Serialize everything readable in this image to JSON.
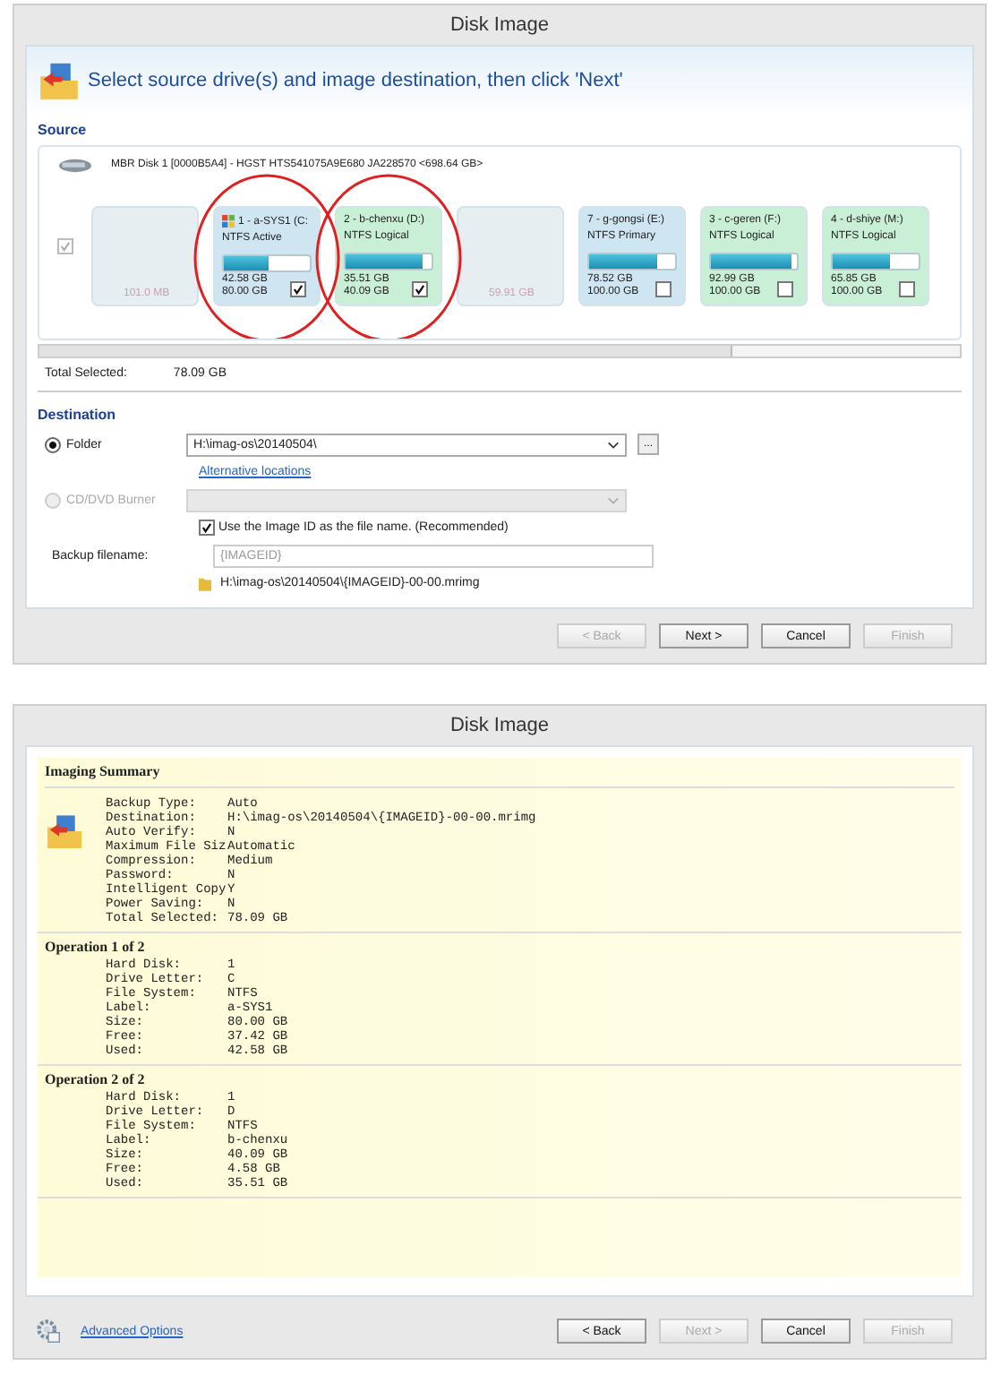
{
  "source_dialog": {
    "title": "Disk Image",
    "instruction": "Select source drive(s) and image destination, then click 'Next'",
    "source": {
      "heading": "Source",
      "disk_label": "MBR Disk 1 [0000B5A4] - HGST HTS541075A9E680 JA228570  <698.64 GB>",
      "disk_checked": true,
      "disk_disabled": true,
      "partitions": [
        {
          "kind": "unallocated",
          "size": "101.0 MB"
        },
        {
          "kind": "primary",
          "name": "1 - a-SYS1 (C:",
          "fs": "NTFS Active",
          "system": true,
          "highlighted": true,
          "level": 0.53,
          "used": "42.58 GB",
          "total": "80.00 GB",
          "checked": true
        },
        {
          "kind": "logical",
          "name": "2 - b-chenxu (D:)",
          "fs": "NTFS Logical",
          "system": false,
          "highlighted": true,
          "level": 0.89,
          "used": "35.51 GB",
          "total": "40.09 GB",
          "checked": true
        },
        {
          "kind": "unallocated",
          "size": "59.91 GB"
        },
        {
          "kind": "primary",
          "name": "7 - g-gongsi (E:)",
          "fs": "NTFS Primary",
          "system": false,
          "highlighted": false,
          "level": 0.79,
          "used": "78.52 GB",
          "total": "100.00 GB",
          "checked": false
        },
        {
          "kind": "logical",
          "name": "3 - c-geren (F:)",
          "fs": "NTFS Logical",
          "system": false,
          "highlighted": false,
          "level": 0.93,
          "used": "92.99 GB",
          "total": "100.00 GB",
          "checked": false
        },
        {
          "kind": "logical",
          "name": "4 - d-shiye (M:)",
          "fs": "NTFS Logical",
          "system": false,
          "highlighted": false,
          "level": 0.66,
          "used": "65.85 GB",
          "total": "100.00 GB",
          "checked": false
        }
      ],
      "total_label": "Total Selected:",
      "total_value": "78.09 GB"
    },
    "destination": {
      "heading": "Destination",
      "folder": {
        "label": "Folder",
        "selected": true,
        "value": "H:\\imag-os\\20140504\\",
        "browse": "..."
      },
      "link": "Alternative locations",
      "burner": {
        "label": "CD/DVD Burner",
        "selected": false,
        "disabled": true
      },
      "use_id": {
        "label": "Use the Image ID as the file name.  (Recommended)",
        "checked": true
      },
      "filename_label": "Backup filename:",
      "filename_placeholder": "{IMAGEID}",
      "path": "H:\\imag-os\\20140504\\{IMAGEID}-00-00.mrimg"
    },
    "buttons": [
      {
        "label": "< Back",
        "disabled": true
      },
      {
        "label": "Next >",
        "disabled": false
      },
      {
        "label": "Cancel",
        "disabled": false
      },
      {
        "label": "Finish",
        "disabled": true
      }
    ]
  },
  "summary_dialog": {
    "title": "Disk Image",
    "sections": [
      {
        "heading": "Imaging Summary",
        "icon": true,
        "rows": [
          [
            "Backup Type:",
            "Auto"
          ],
          [
            "Destination:",
            "H:\\imag-os\\20140504\\{IMAGEID}-00-00.mrimg"
          ],
          [
            "Auto Verify:",
            "N"
          ],
          [
            "Maximum File Siz",
            "Automatic"
          ],
          [
            "Compression:",
            "Medium"
          ],
          [
            "Password:",
            "N"
          ],
          [
            "Intelligent Copy",
            "Y"
          ],
          [
            "Power Saving:",
            "N"
          ],
          [
            "Total Selected:",
            "78.09 GB"
          ]
        ]
      },
      {
        "heading": "Operation 1 of 2",
        "icon": false,
        "rows": [
          [
            "Hard Disk:",
            "1"
          ],
          [
            "Drive Letter:",
            "C"
          ],
          [
            "File System:",
            "NTFS"
          ],
          [
            "Label:",
            "a-SYS1"
          ],
          [
            "Size:",
            "80.00 GB"
          ],
          [
            "Free:",
            "37.42 GB"
          ],
          [
            "Used:",
            "42.58 GB"
          ]
        ]
      },
      {
        "heading": "Operation 2 of 2",
        "icon": false,
        "rows": [
          [
            "Hard Disk:",
            "1"
          ],
          [
            "Drive Letter:",
            "D"
          ],
          [
            "File System:",
            "NTFS"
          ],
          [
            "Label:",
            "b-chenxu"
          ],
          [
            "Size:",
            "40.09 GB"
          ],
          [
            "Free:",
            "4.58 GB"
          ],
          [
            "Used:",
            "35.51 GB"
          ]
        ]
      }
    ],
    "link": "Advanced Options",
    "buttons": [
      {
        "label": "< Back",
        "disabled": false
      },
      {
        "label": "Next >",
        "disabled": true
      },
      {
        "label": "Cancel",
        "disabled": false
      },
      {
        "label": "Finish",
        "disabled": true
      }
    ]
  }
}
